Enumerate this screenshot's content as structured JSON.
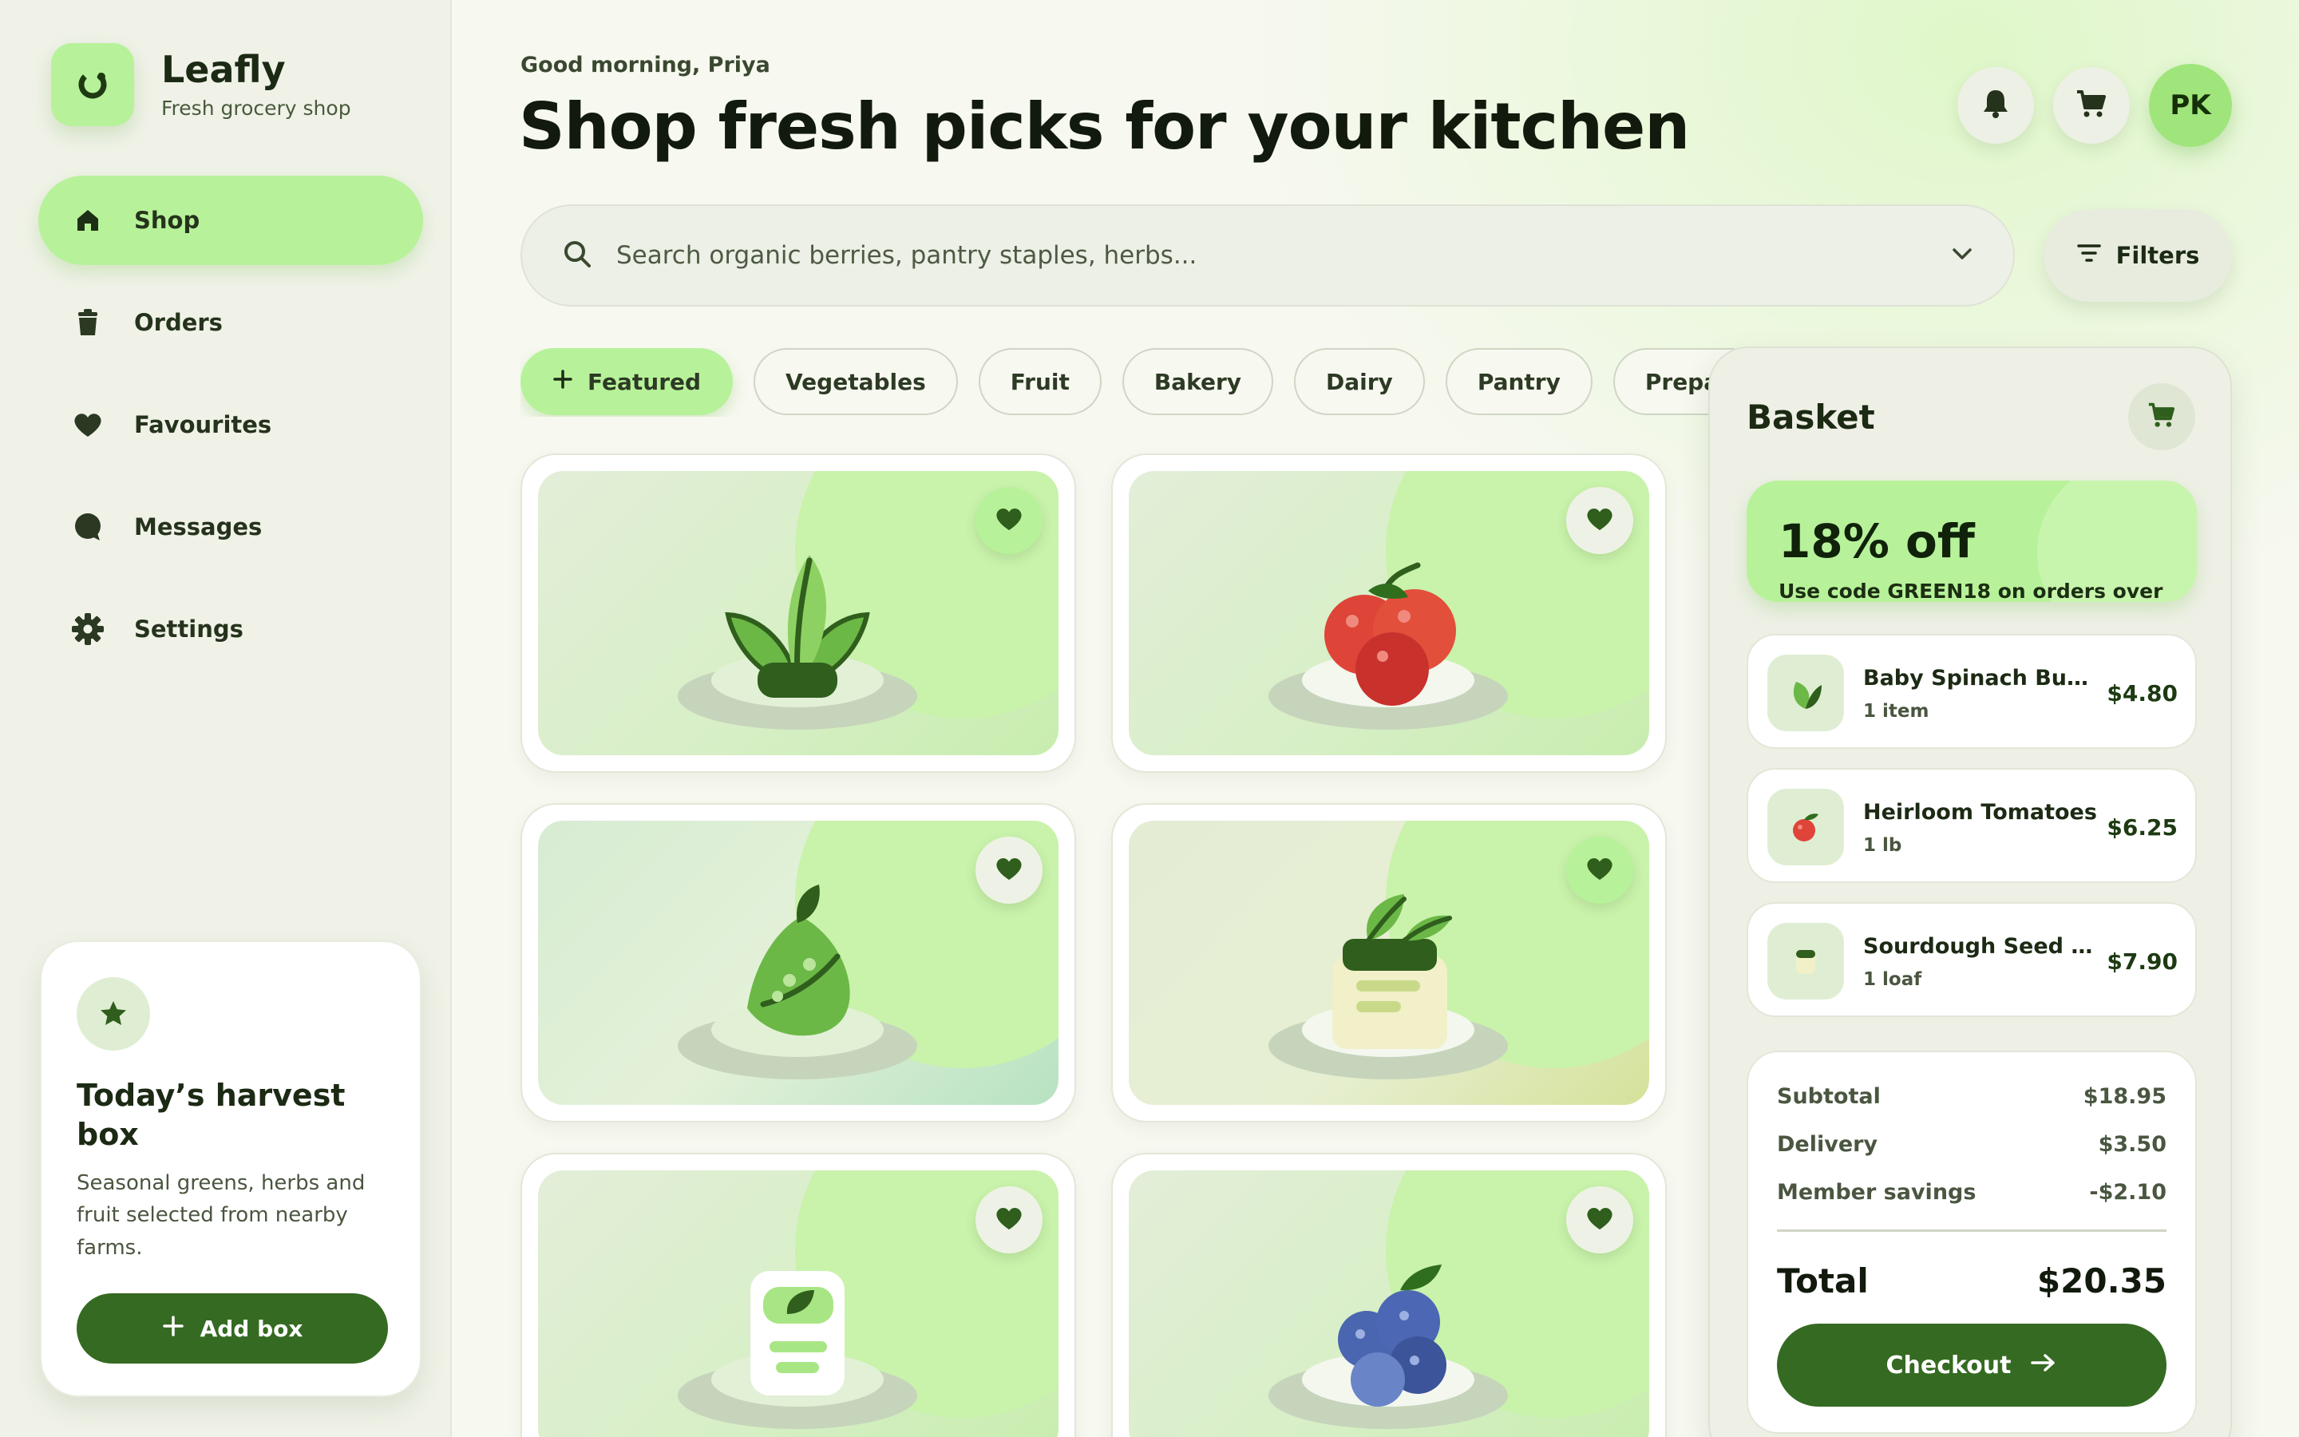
{
  "brand": {
    "name": "Leafly",
    "subtitle": "Fresh grocery shop"
  },
  "nav": {
    "items": [
      {
        "label": "Shop",
        "icon": "home-icon",
        "active": true
      },
      {
        "label": "Orders",
        "icon": "bag-icon"
      },
      {
        "label": "Favourites",
        "icon": "heart-icon"
      },
      {
        "label": "Messages",
        "icon": "chat-bubble-icon"
      },
      {
        "label": "Settings",
        "icon": "gear-icon"
      }
    ]
  },
  "harvest": {
    "title": "Today’s harvest box",
    "description": "Seasonal greens, herbs and fruit selected from nearby farms.",
    "button_label": "Add box",
    "icon": "star-icon"
  },
  "header": {
    "greeting": "Good morning, Priya",
    "title": "Shop fresh picks for your kitchen",
    "avatar_initials": "PK"
  },
  "search": {
    "placeholder": "Search organic berries, pantry staples, herbs..."
  },
  "filters": {
    "label": "Filters"
  },
  "categories": [
    "Featured",
    "Vegetables",
    "Fruit",
    "Bakery",
    "Dairy",
    "Pantry",
    "Prepared meals"
  ],
  "products": [
    {
      "icon": "spinach-icon",
      "favourite": true
    },
    {
      "icon": "tomato-icon",
      "favourite": false
    },
    {
      "icon": "pear-icon",
      "favourite": false
    },
    {
      "icon": "herb-pot-icon",
      "favourite": true
    },
    {
      "icon": "jar-icon",
      "favourite": false
    },
    {
      "icon": "blueberries-icon",
      "favourite": false
    }
  ],
  "basket": {
    "title": "Basket",
    "promo": {
      "value": "18% off",
      "text": "Use code GREEN18 on orders over"
    },
    "items": [
      {
        "name": "Baby Spinach Bundle",
        "qty": "1 item",
        "price": "$4.80",
        "icon": "leaf-icon"
      },
      {
        "name": "Heirloom Tomatoes",
        "qty": "1 lb",
        "price": "$6.25",
        "icon": "tomato-icon"
      },
      {
        "name": "Sourdough Seed Loaf",
        "qty": "1 loaf",
        "price": "$7.90",
        "icon": "bread-icon"
      }
    ],
    "summary": {
      "subtotal_label": "Subtotal",
      "subtotal": "$18.95",
      "delivery_label": "Delivery",
      "delivery": "$3.50",
      "savings_label": "Member savings",
      "savings": "-$2.10",
      "total_label": "Total",
      "total": "$20.35"
    },
    "checkout_label": "Checkout"
  },
  "colors": {
    "accent": "#b7f29a",
    "primary_dark": "#356a22",
    "background": "#f7f8f0"
  }
}
